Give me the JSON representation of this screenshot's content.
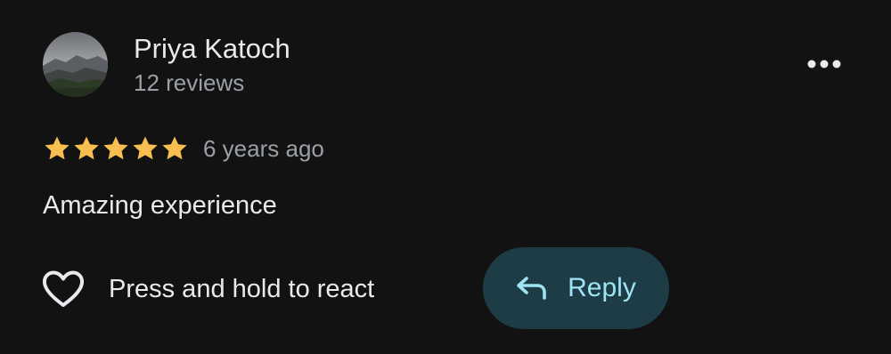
{
  "review": {
    "reviewer_name": "Priya Katoch",
    "review_count": "12 reviews",
    "rating": 5,
    "rating_max": 5,
    "date": "6 years ago",
    "text": "Amazing experience"
  },
  "actions": {
    "react_label": "Press and hold to react",
    "reply_label": "Reply"
  },
  "icons": {
    "more": "more-horizontal-icon",
    "react": "heart-outline-icon",
    "reply": "reply-arrow-icon",
    "star": "star-filled-icon"
  },
  "colors": {
    "background": "#121212",
    "primary_text": "#e8eaed",
    "secondary_text": "#9aa0a6",
    "star": "#f7bf4f",
    "reply_bg": "#1d3c45",
    "reply_text": "#9fe4f2"
  }
}
